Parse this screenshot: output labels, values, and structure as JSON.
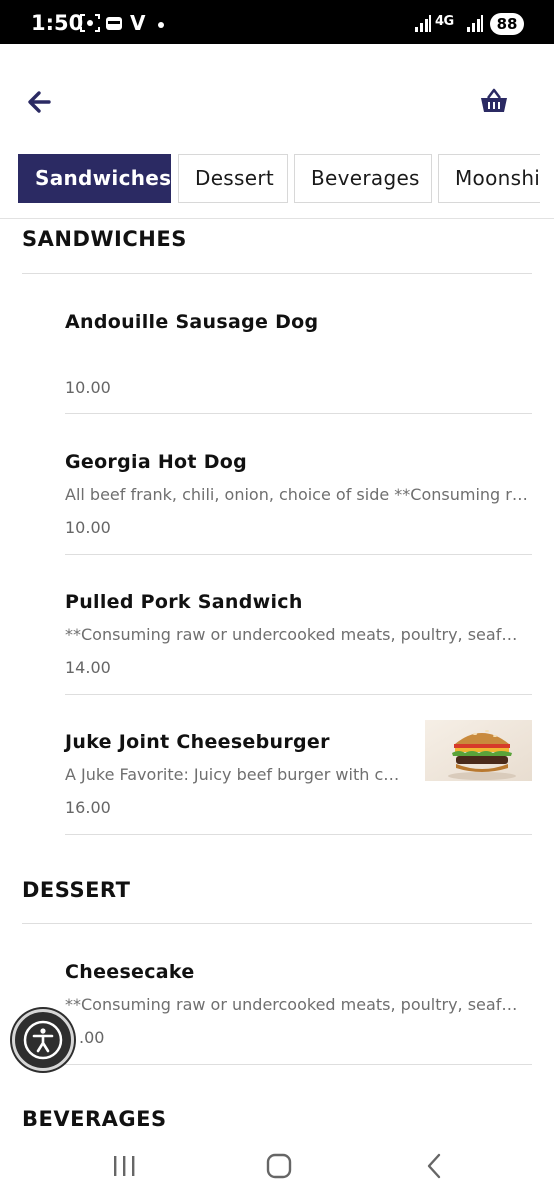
{
  "status_bar": {
    "time": "1:50",
    "carrier_glyph": "V",
    "network": "4G",
    "battery": "88"
  },
  "header": {
    "back_icon": "arrow-left-icon",
    "basket_icon": "basket-icon",
    "accent_color": "#2b2a63"
  },
  "tabs": [
    {
      "label": "Sandwiches",
      "active": true
    },
    {
      "label": "Dessert",
      "active": false
    },
    {
      "label": "Beverages",
      "active": false
    },
    {
      "label": "Moonshine",
      "active": false
    }
  ],
  "sections": {
    "sandwiches": {
      "title": "SANDWICHES",
      "items": [
        {
          "name": "Andouille Sausage Dog",
          "description": "",
          "price": "10.00"
        },
        {
          "name": "Georgia Hot Dog",
          "description": "All beef frank, chili, onion, choice of side **Consuming raw or undercooked meats",
          "price": "10.00"
        },
        {
          "name": "Pulled Pork Sandwich",
          "description": "**Consuming raw or undercooked meats, poultry, seafood",
          "price": "14.00"
        },
        {
          "name": "Juke Joint Cheeseburger",
          "description": "A Juke Favorite: Juicy beef burger with cheese",
          "price": "16.00",
          "image_icon": "burger-photo"
        }
      ]
    },
    "dessert": {
      "title": "DESSERT",
      "items": [
        {
          "name": "Cheesecake",
          "description": "**Consuming raw or undercooked meats, poultry, seafood",
          "price": ".00"
        }
      ]
    },
    "beverages": {
      "title": "BEVERAGES"
    }
  },
  "accessibility": {
    "icon": "accessibility-icon"
  },
  "nav_bar": {
    "recents_icon": "recents-icon",
    "home_icon": "home-icon",
    "back_icon": "nav-back-icon"
  }
}
